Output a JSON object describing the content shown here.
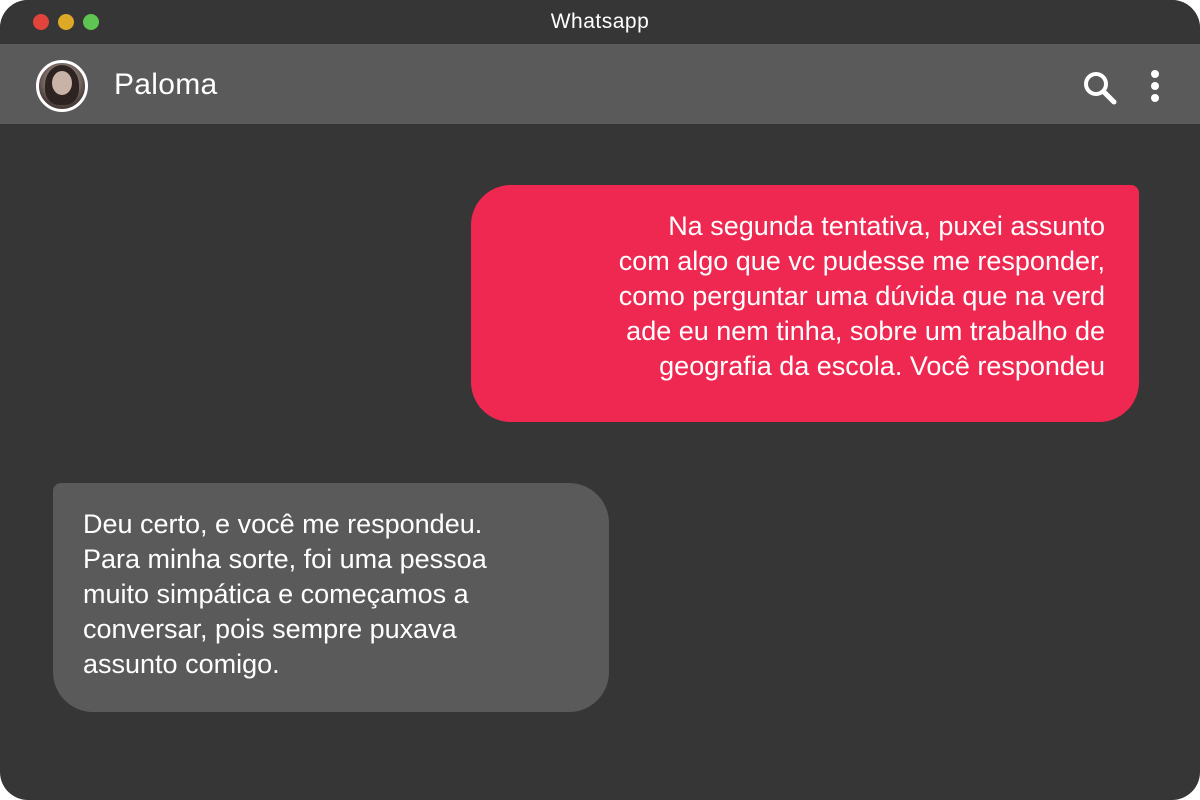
{
  "window": {
    "title": "Whatsapp"
  },
  "chat": {
    "contact_name": "Paloma",
    "avatar_icon": "avatar-photo",
    "actions": {
      "search_icon": "search-icon",
      "more_icon": "more-vertical-icon"
    }
  },
  "messages": [
    {
      "direction": "outgoing",
      "color": "#ee2851",
      "lines": [
        "Na segunda tentativa, puxei assunto",
        "com algo que vc pudesse me responder,",
        "como perguntar uma dúvida que na verd",
        "ade eu nem tinha, sobre um trabalho de",
        "geografia da escola. Você respondeu"
      ]
    },
    {
      "direction": "incoming",
      "color": "#5a5a5a",
      "lines": [
        "Deu certo, e você me respondeu.",
        "Para minha sorte, foi uma pessoa",
        "muito simpática e começamos a",
        "conversar, pois sempre puxava",
        "assunto comigo."
      ]
    }
  ],
  "colors": {
    "background": "#363636",
    "header": "#5a5a5a",
    "outgoing_bubble": "#ee2851",
    "incoming_bubble": "#5a5a5a",
    "close": "#e0443a",
    "minimize": "#dfa928",
    "zoom": "#5ec452"
  }
}
